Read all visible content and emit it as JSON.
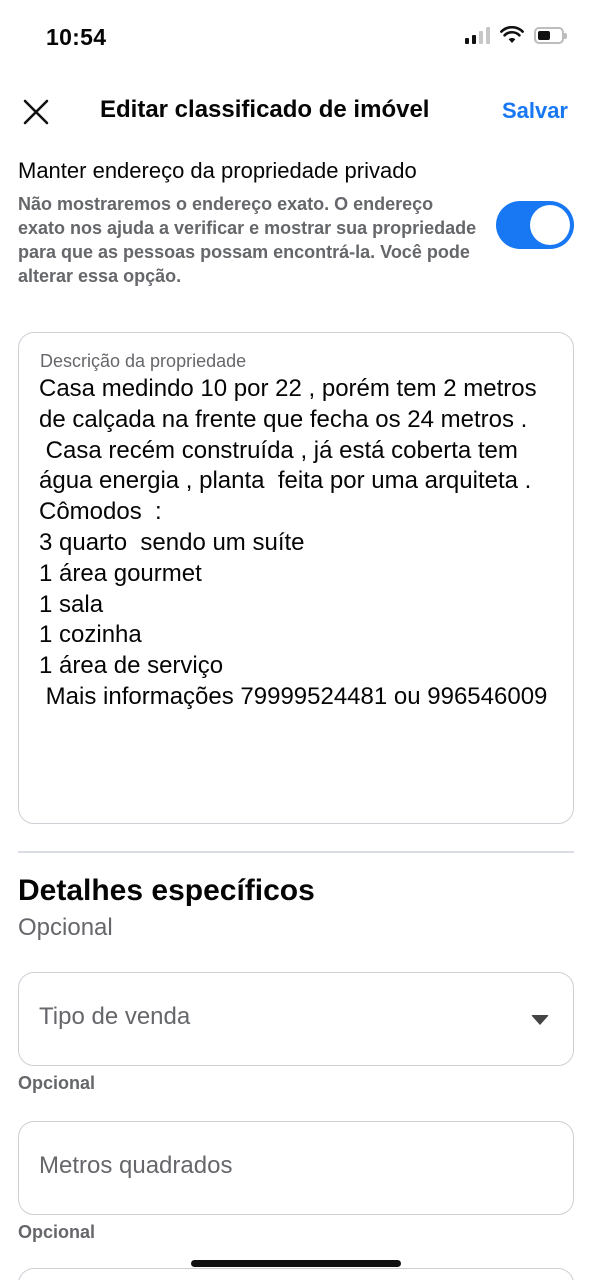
{
  "status_bar": {
    "time": "10:54"
  },
  "header": {
    "close_icon": "close-icon",
    "title": "Editar classificado de imóvel",
    "save_label": "Salvar"
  },
  "privacy": {
    "title": "Manter endereço da propriedade privado",
    "description": "Não mostraremos o endereço exato. O endereço exato nos ajuda a verificar e mostrar sua propriedade para que as pessoas possam encontrá-la. Você pode alterar essa opção.",
    "toggle_on": true
  },
  "description": {
    "label": "Descrição da propriedade",
    "value": "Casa medindo 10 por 22 , porém tem 2 metros de calçada na frente que fecha os 24 metros .\n Casa recém construída , já está coberta tem água energia , planta  feita por uma arquiteta .\nCômodos  :\n3 quarto  sendo um suíte\n1 área gourmet\n1 sala\n1 cozinha\n1 área de serviço\n Mais informações 79999524481 ou 996546009"
  },
  "details": {
    "title": "Detalhes específicos",
    "subtitle": "Opcional",
    "fields": [
      {
        "placeholder": "Tipo de venda",
        "helper": "Opcional"
      },
      {
        "placeholder": "Metros quadrados",
        "helper": "Opcional"
      }
    ]
  },
  "colors": {
    "accent": "#1877f2",
    "secondary_text": "#65676b",
    "border": "#ccd0d5"
  }
}
